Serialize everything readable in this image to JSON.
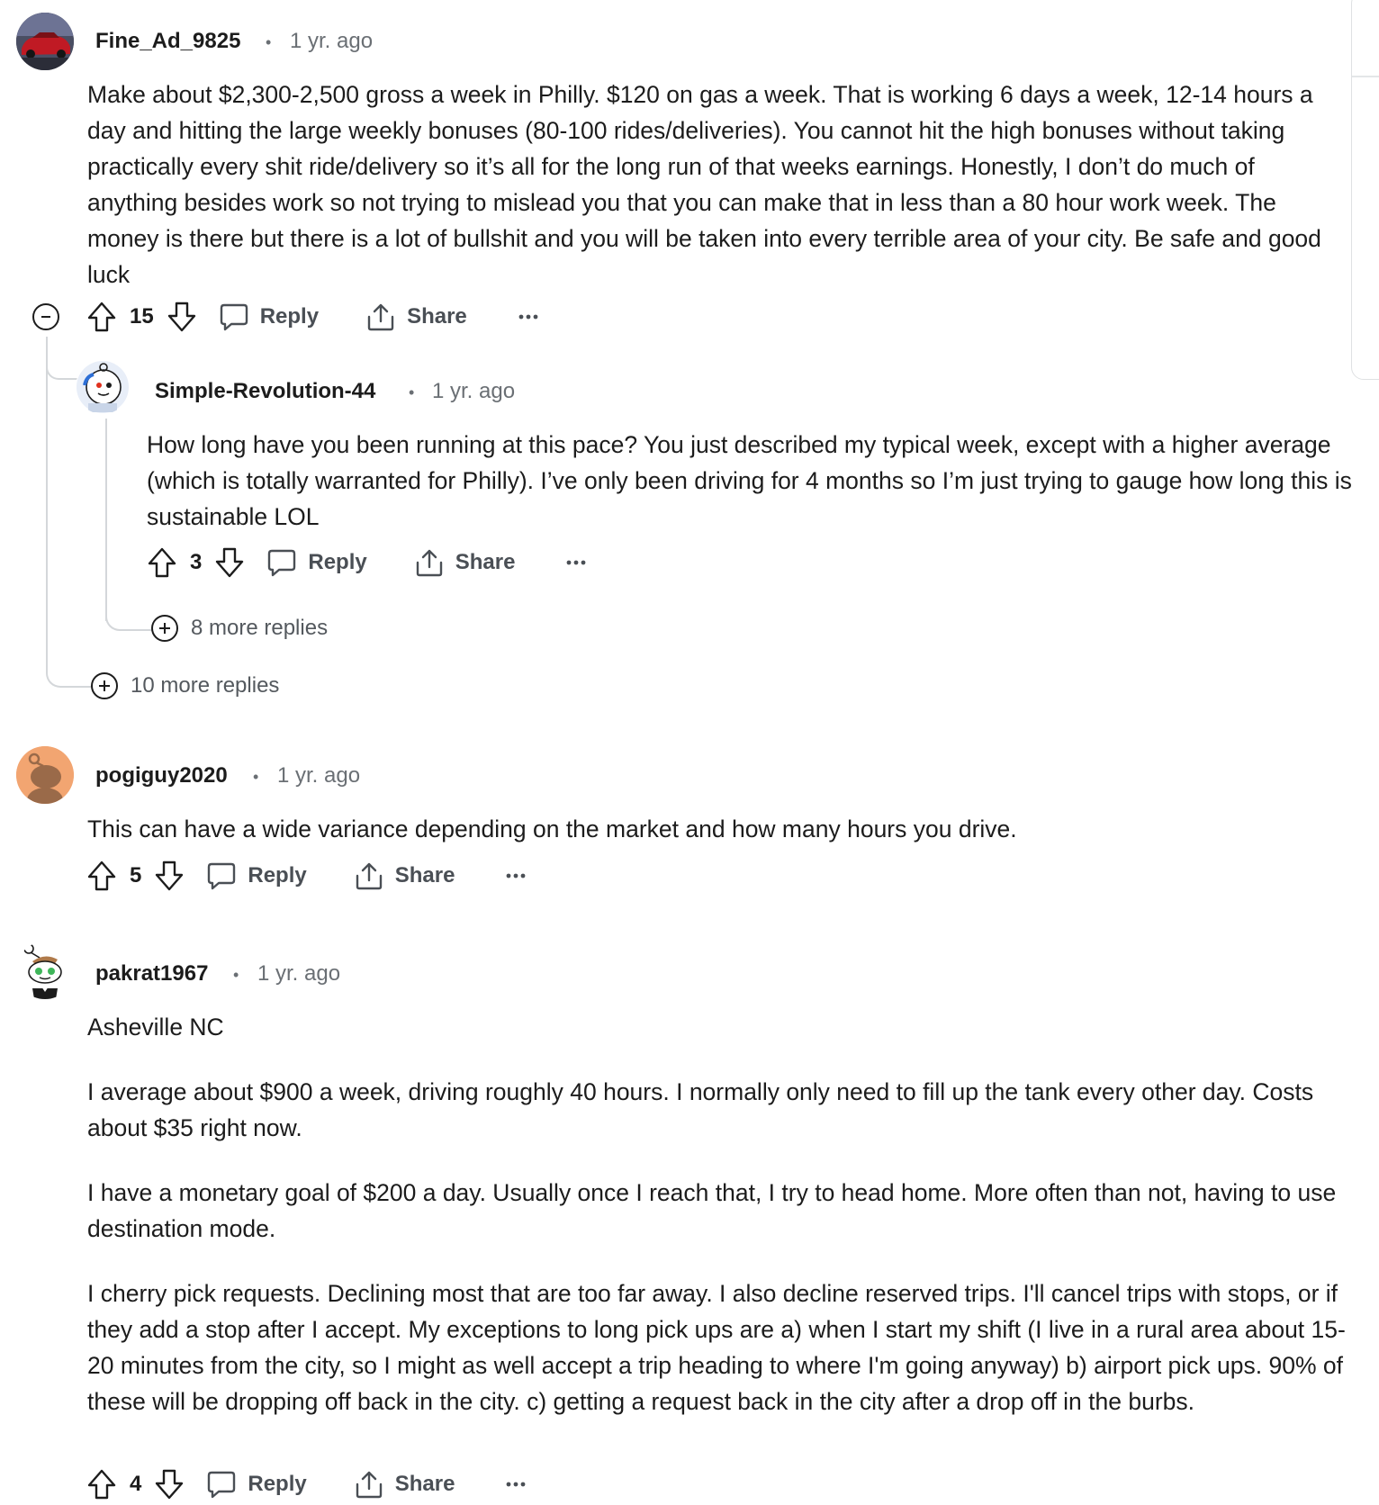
{
  "comments": [
    {
      "author": "Fine_Ad_9825",
      "time": "1 yr. ago",
      "body": [
        "Make about $2,300-2,500 gross a week in Philly. $120 on gas a week. That is working 6 days a week, 12-14 hours a day and hitting the large weekly bonuses (80-100 rides/deliveries). You cannot hit the high bonuses without taking practically every shit ride/delivery so it’s all for the long run of that weeks earnings. Honestly, I don’t do much of anything besides work so not trying to mislead you that you can make that in less than a 80 hour work week. The money is there but there is a lot of bullshit and you will be taken into every terrible area of your city. Be safe and good luck"
      ],
      "votes": "15",
      "more_replies": "10 more replies",
      "avatar_icon": "car-avatar-icon"
    },
    {
      "author": "Simple-Revolution-44",
      "time": "1 yr. ago",
      "body": [
        "How long have you been running at this pace? You just described my typical week, except with a higher average (which is totally warranted for Philly). I’ve only been driving for 4 months so I’m just trying to gauge how long this is sustainable LOL"
      ],
      "votes": "3",
      "more_replies": "8 more replies",
      "avatar_icon": "snoo-avatar-icon"
    },
    {
      "author": "pogiguy2020",
      "time": "1 yr. ago",
      "body": [
        "This can have a wide variance depending on the market and how many hours you drive."
      ],
      "votes": "5",
      "avatar_icon": "snoo-avatar-icon"
    },
    {
      "author": "pakrat1967",
      "time": "1 yr. ago",
      "body": [
        "Asheville NC",
        "I average about $900 a week, driving roughly 40 hours. I normally only need to fill up the tank every other day. Costs about $35 right now.",
        "I have a monetary goal of $200 a day. Usually once I reach that, I try to head home. More often than not, having to use destination mode.",
        "I cherry pick requests. Declining most that are too far away. I also decline reserved trips. I'll cancel trips with stops, or if they add a stop after I accept. My exceptions to long pick ups are a) when I start my shift (I live in a rural area about 15-20 minutes from the city, so I might as well accept a trip heading to where I'm going anyway) b) airport pick ups. 90% of these will be dropping off back in the city. c) getting a request back in the city after a drop off in the burbs."
      ],
      "votes": "4",
      "avatar_icon": "snoo-avatar-icon"
    }
  ],
  "labels": {
    "reply": "Reply",
    "share": "Share",
    "dot": "•"
  },
  "colors": {
    "text": "#1c1c1c",
    "meta": "#6a6f74",
    "thread": "#d4d7da",
    "pogi_avatar_bg": "#f2a571"
  }
}
